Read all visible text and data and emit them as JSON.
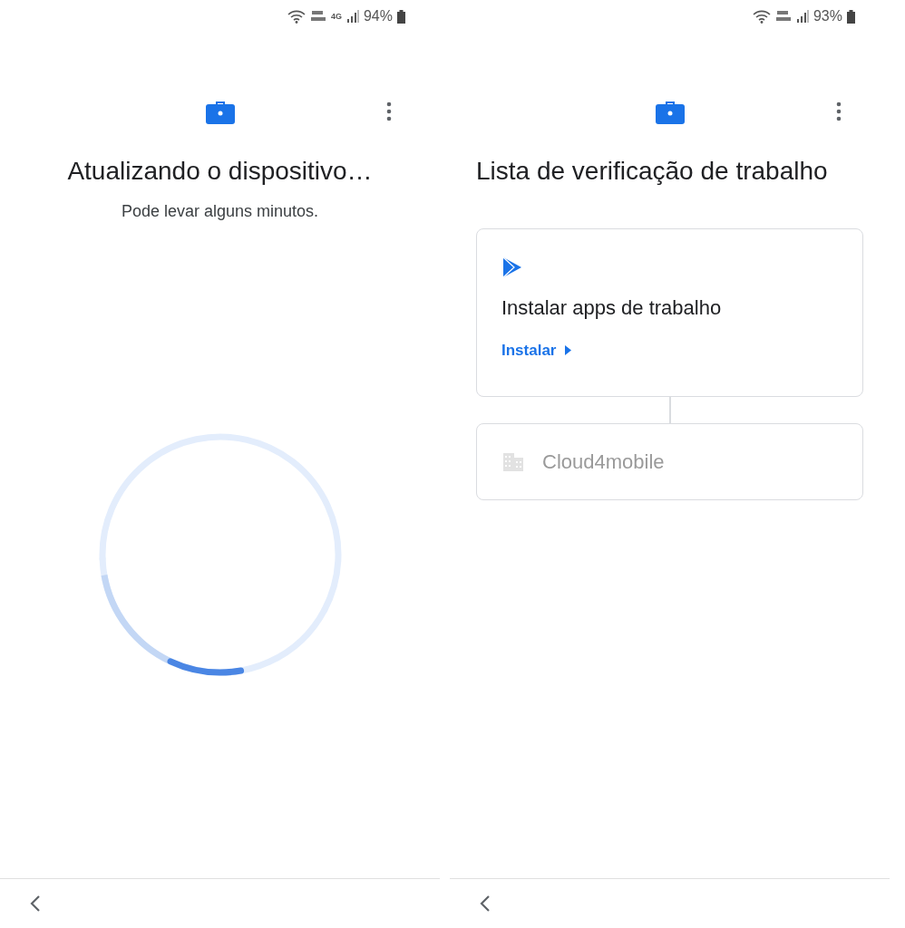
{
  "screens": [
    {
      "status_bar": {
        "battery": "94%",
        "network_type": "4G"
      },
      "title": "Atualizando o dispositivo…",
      "subtitle": "Pode levar alguns minutos.",
      "kind": "progress"
    },
    {
      "status_bar": {
        "battery": "93%"
      },
      "title": "Lista de verificação de trabalho",
      "kind": "checklist",
      "items": [
        {
          "kind": "apps",
          "title": "Instalar apps de trabalho",
          "link": "Instalar",
          "disabled": false
        },
        {
          "kind": "organization",
          "title": "Cloud4mobile",
          "disabled": true
        }
      ]
    }
  ]
}
